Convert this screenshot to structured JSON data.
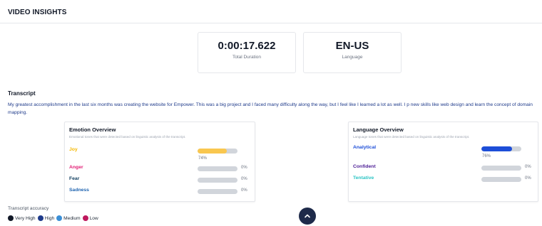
{
  "header": {
    "title": "VIDEO INSIGHTS"
  },
  "stats": {
    "duration": {
      "value": "0:00:17.622",
      "label": "Total Duration"
    },
    "language": {
      "value": "EN-US",
      "label": "Language"
    }
  },
  "transcript": {
    "heading": "Transcript",
    "text": "My greatest accomplishment in the last six months was creating the website for Empower. This was a big project and I faced many difficulty along the way, but I feel like I learned a lot as well. I p new skills like web design and learn the concept of domain mapping."
  },
  "emotion_overview": {
    "title": "Emotion Overview",
    "subtitle": "Emotional tones that were detected based on linguistic analysis of the transcript.",
    "rows": [
      {
        "label": "Joy",
        "percent": 74,
        "percent_text": "74%",
        "color": "#f5b800",
        "bar_color": "#f9c74f"
      },
      {
        "label": "Anger",
        "percent": 0,
        "percent_text": "0%",
        "color": "#e11d74",
        "bar_color": "#e11d74"
      },
      {
        "label": "Fear",
        "percent": 0,
        "percent_text": "0%",
        "color": "#0f3d5e",
        "bar_color": "#0f3d5e"
      },
      {
        "label": "Sadness",
        "percent": 0,
        "percent_text": "0%",
        "color": "#1e63b0",
        "bar_color": "#1e63b0"
      }
    ]
  },
  "language_overview": {
    "title": "Language Overview",
    "subtitle": "Language tones that were detected based on linguistic analysis of the transcript.",
    "rows": [
      {
        "label": "Analytical",
        "percent": 76,
        "percent_text": "76%",
        "color": "#1d4ed8",
        "bar_color": "#1d4ed8"
      },
      {
        "label": "Confident",
        "percent": 0,
        "percent_text": "0%",
        "color": "#4c1d95",
        "bar_color": "#4c1d95"
      },
      {
        "label": "Tentative",
        "percent": 0,
        "percent_text": "0%",
        "color": "#2cc4c4",
        "bar_color": "#2cc4c4"
      }
    ]
  },
  "accuracy": {
    "title": "Transcript accuracy",
    "legend": [
      {
        "label": "Very High",
        "color": "#111827"
      },
      {
        "label": "High",
        "color": "#1e3a8a"
      },
      {
        "label": "Medium",
        "color": "#3b8fd6"
      },
      {
        "label": "Low",
        "color": "#be185d"
      }
    ]
  },
  "scroll_top": {
    "icon": "chevron-up-icon"
  }
}
